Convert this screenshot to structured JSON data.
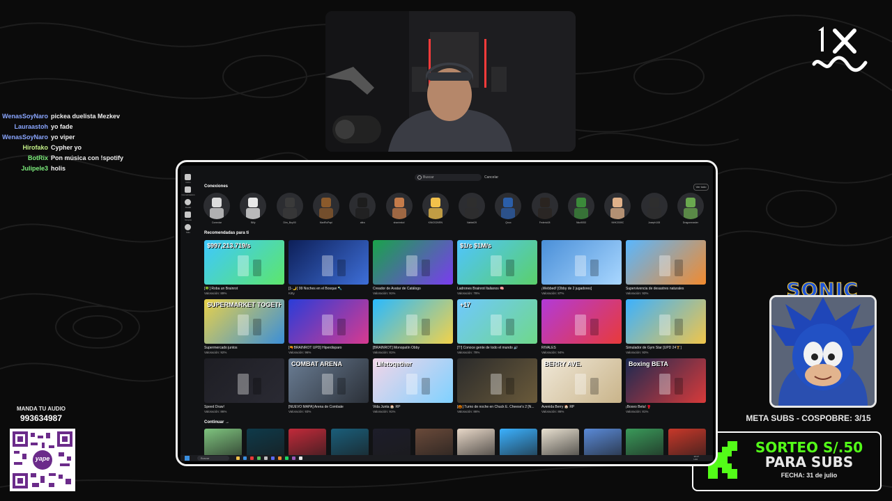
{
  "chat": [
    {
      "user": "WenasSoyNaro",
      "color": "#8aa6ff",
      "message": "pickea duelista Mezkev"
    },
    {
      "user": "Lauraastoh",
      "color": "#8aa6ff",
      "message": "yo fade"
    },
    {
      "user": "WenasSoyNaro",
      "color": "#8aa6ff",
      "message": "yo viper"
    },
    {
      "user": "Hirofako",
      "color": "#c6f28a",
      "message": "Cypher yo"
    },
    {
      "user": "BotRix",
      "color": "#7ef07e",
      "message": "Pon música con !spotify"
    },
    {
      "user": "Julipele3",
      "color": "#7ef07e",
      "message": "holis"
    }
  ],
  "audio": {
    "label": "MANDA TU AUDIO",
    "number": "993634987",
    "qr_text": "yape"
  },
  "sonic": {
    "title": "SONIC"
  },
  "meta_subs": "META SUBS - COSPOBRE: 3/15",
  "sorteo": {
    "title": "SORTEO S/.50",
    "subtitle": "PARA SUBS",
    "date": "FECHA: 31 de julio"
  },
  "browser": {
    "search_placeholder": "Buscar",
    "cancel_label": "Cancelar",
    "connections_title": "Conexiones",
    "see_all": "Ver todo",
    "left_nav": [
      "Inicio",
      "Comunicación",
      "Avatar",
      "Grupos",
      "Más"
    ],
    "friends": [
      {
        "name": "Conectar",
        "color": "#dcdcdc"
      },
      {
        "name": "Billy",
        "color": "#e8e8e8"
      },
      {
        "name": "Dim_Boy00",
        "color": "#3a3a3a"
      },
      {
        "name": "MarlRuPapi",
        "color": "#8b5a2b"
      },
      {
        "name": "altra",
        "color": "#1d1d1d"
      },
      {
        "name": "shanimkol",
        "color": "#c47b4a"
      },
      {
        "name": "KINGS2NRN",
        "color": "#f2c14b"
      },
      {
        "name": "Nahtel29",
        "color": "#2e2e2e"
      },
      {
        "name": "Qnox",
        "color": "#2b5ea8"
      },
      {
        "name": "Federic08",
        "color": "#2a2420"
      },
      {
        "name": "Nko9053",
        "color": "#3b8a3a"
      },
      {
        "name": "NHK2009C",
        "color": "#e0b18a"
      },
      {
        "name": "Joseph108",
        "color": "#2e2e2e"
      },
      {
        "name": "Dragonmaster",
        "color": "#6aa84f"
      }
    ],
    "recommended_title": "Recomendadas para ti",
    "games": [
      {
        "title": "[🍀] Roba un Brainrot",
        "rating": "Valoración: 89%",
        "c1": "#3ec8ff",
        "c2": "#5de66b",
        "overlay": "$997,213,719/s"
      },
      {
        "title": "[1-🌙] 99 Noches en el Bosque 🔦",
        "rating": "Kitty",
        "c1": "#0d1f58",
        "c2": "#3e6fd8",
        "overlay": ""
      },
      {
        "title": "Creador de Avatar de Catálogo",
        "rating": "Valoración: 91%",
        "c1": "#19a34a",
        "c2": "#7a3cf0",
        "overlay": ""
      },
      {
        "title": "Ladrones Brainrot Italianos 🧠",
        "rating": "Valoración: 78%",
        "c1": "#4fc4ff",
        "c2": "#5bd06a",
        "overlay": "$1/s  $1M/s"
      },
      {
        "title": "¡Webbed! [Obby de 2 jugadores]",
        "rating": "Valoración: 87%",
        "c1": "#4a8fd8",
        "c2": "#a9d7ff",
        "overlay": ""
      },
      {
        "title": "Supervivencia de desastres naturales",
        "rating": "Valoración: 93%",
        "c1": "#59b7ff",
        "c2": "#f28a2e",
        "overlay": ""
      },
      {
        "title": "Supermercado juntos",
        "rating": "Valoración: 92%",
        "c1": "#e8d14a",
        "c2": "#3b8fd8",
        "overlay": "SUPERMARKET TOGETHER"
      },
      {
        "title": "[🔫BRAINROT UPD] Hiperdisparo",
        "rating": "Valoración: 96%",
        "c1": "#2a3dd8",
        "c2": "#d83a8f",
        "overlay": ""
      },
      {
        "title": "[BRAINROT] Monopatín Obby",
        "rating": "Valoración: 81%",
        "c1": "#29b9ff",
        "c2": "#f2d24a",
        "overlay": ""
      },
      {
        "title": "[T!] Conoce gente de todo el mundo 🔊",
        "rating": "Valoración: 78%",
        "c1": "#6fc8ff",
        "c2": "#6fd88a",
        "overlay": "+17"
      },
      {
        "title": "RIVALES",
        "rating": "Valoración: 94%",
        "c1": "#b23ad8",
        "c2": "#e83a3a",
        "overlay": ""
      },
      {
        "title": "Simulador de Gym Star [UPD 24🏋]",
        "rating": "Valoración: 93%",
        "c1": "#3bb1ff",
        "c2": "#f0c54a",
        "overlay": ""
      },
      {
        "title": "Speed Draw!",
        "rating": "Valoración: 86%",
        "c1": "#1e1e24",
        "c2": "#2a2a33",
        "overlay": ""
      },
      {
        "title": "[NUEVO MAPA] Arena de Combate",
        "rating": "Valoración: 93%",
        "c1": "#6a7d94",
        "c2": "#2b3038",
        "overlay": "COMBAT ARENA"
      },
      {
        "title": "Vida Junta 🏠 RP",
        "rating": "Valoración: 91%",
        "c1": "#f2d5e8",
        "c2": "#7fd1ff",
        "overlay": "Lifetogether"
      },
      {
        "title": "[🎃] Turno de noche en Chuck E. Cheese's 2 [N...",
        "rating": "Valoración: 86%",
        "c1": "#2b2b2b",
        "c2": "#6a5a3a",
        "overlay": ""
      },
      {
        "title": "Avenida Berry 🏠 RP",
        "rating": "Valoración: 86%",
        "c1": "#f0e8d8",
        "c2": "#c9b48a",
        "overlay": "BERRY AVE."
      },
      {
        "title": "¡Boxeo Beta! 🥊",
        "rating": "Valoración: 81%",
        "c1": "#1c2a52",
        "c2": "#d83a3a",
        "overlay": "Boxing BETA"
      }
    ],
    "continue_title": "Continuar →",
    "continue_items": [
      {
        "color": "#7fc47f"
      },
      {
        "color": "#0e3a4a"
      },
      {
        "color": "#c22a3a"
      },
      {
        "color": "#1a5e7a"
      },
      {
        "color": "#1d1d2a"
      },
      {
        "color": "#6a4a3a"
      },
      {
        "color": "#e8d8c8"
      },
      {
        "color": "#3bb1ff"
      },
      {
        "color": "#e8e0d0"
      },
      {
        "color": "#5a8ad8"
      },
      {
        "color": "#3a9a5a"
      },
      {
        "color": "#c8382a"
      }
    ],
    "taskbar_search": "Buscar",
    "taskbar_time": "13:17",
    "taskbar_date": "LAA"
  }
}
